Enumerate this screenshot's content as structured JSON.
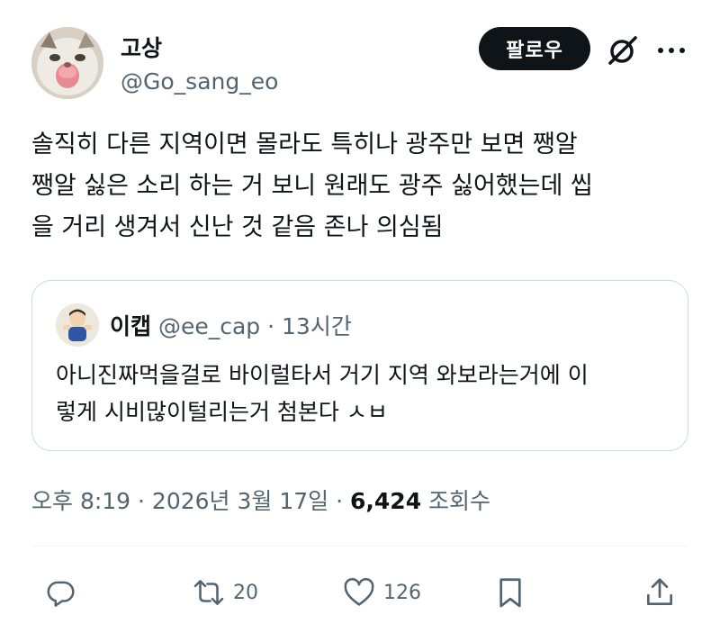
{
  "author": {
    "name": "고상",
    "handle": "@Go_sang_eo",
    "avatar_icon": "cat-avatar"
  },
  "header": {
    "follow_label": "팔로우",
    "grok_icon": "grok-slash-icon",
    "more_icon": "more-dots-icon"
  },
  "tweet": {
    "lines": [
      "솔직히 다른 지역이면 몰라도 특히나 광주만 보면 쨍알",
      "쨍알 싫은 소리 하는 거 보니 원래도 광주 싫어했는데 씹",
      "을 거리 생겨서 신난 것 같음 존나 의심됨"
    ]
  },
  "quote": {
    "name": "이캡",
    "handle": "@ee_cap",
    "time": "· 13시간",
    "lines": [
      "아니진짜먹을걸로 바이럴타서 거기 지역 와보라는거에 이",
      "렇게 시비많이털리는거 첨본다 ㅅㅂ"
    ]
  },
  "meta": {
    "time": "오후 8:19 · 2026년 3월 17일 · ",
    "views": "6,424",
    "views_label": " 조회수"
  },
  "actions": {
    "reply_count": "",
    "repost_count": "20",
    "like_count": "126"
  },
  "colors": {
    "text": "#0f1419",
    "secondary": "#536471",
    "border": "#cfd9de",
    "follow_bg": "#0f1419"
  }
}
